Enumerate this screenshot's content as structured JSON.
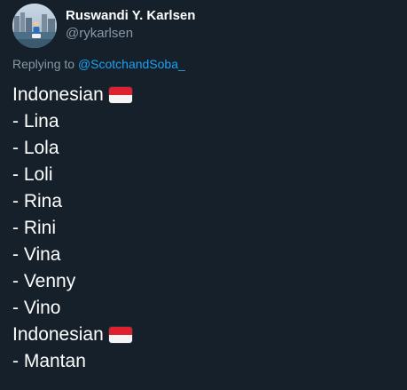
{
  "theme": {
    "background": "#15202b",
    "text": "#ffffff",
    "muted": "#8899a6",
    "link": "#1da1f2",
    "flag_red": "#e0202e",
    "flag_white": "#f4f4f4"
  },
  "author": {
    "display_name": "Ruswandi Y. Karlsen",
    "handle": "@rykarlsen",
    "avatar_icon": "profile-photo"
  },
  "reply": {
    "prefix": "Replying to",
    "target": "@ScotchandSoba_"
  },
  "tweet": {
    "lines": [
      {
        "text": "Indonesian",
        "flag": "indonesia-flag-icon"
      },
      {
        "text": "- Lina"
      },
      {
        "text": "- Lola"
      },
      {
        "text": "- Loli"
      },
      {
        "text": "- Rina"
      },
      {
        "text": "- Rini"
      },
      {
        "text": "- Vina"
      },
      {
        "text": "- Venny"
      },
      {
        "text": "- Vino"
      },
      {
        "text": "Indonesian",
        "flag": "indonesia-flag-icon"
      },
      {
        "text": "- Mantan"
      }
    ]
  }
}
